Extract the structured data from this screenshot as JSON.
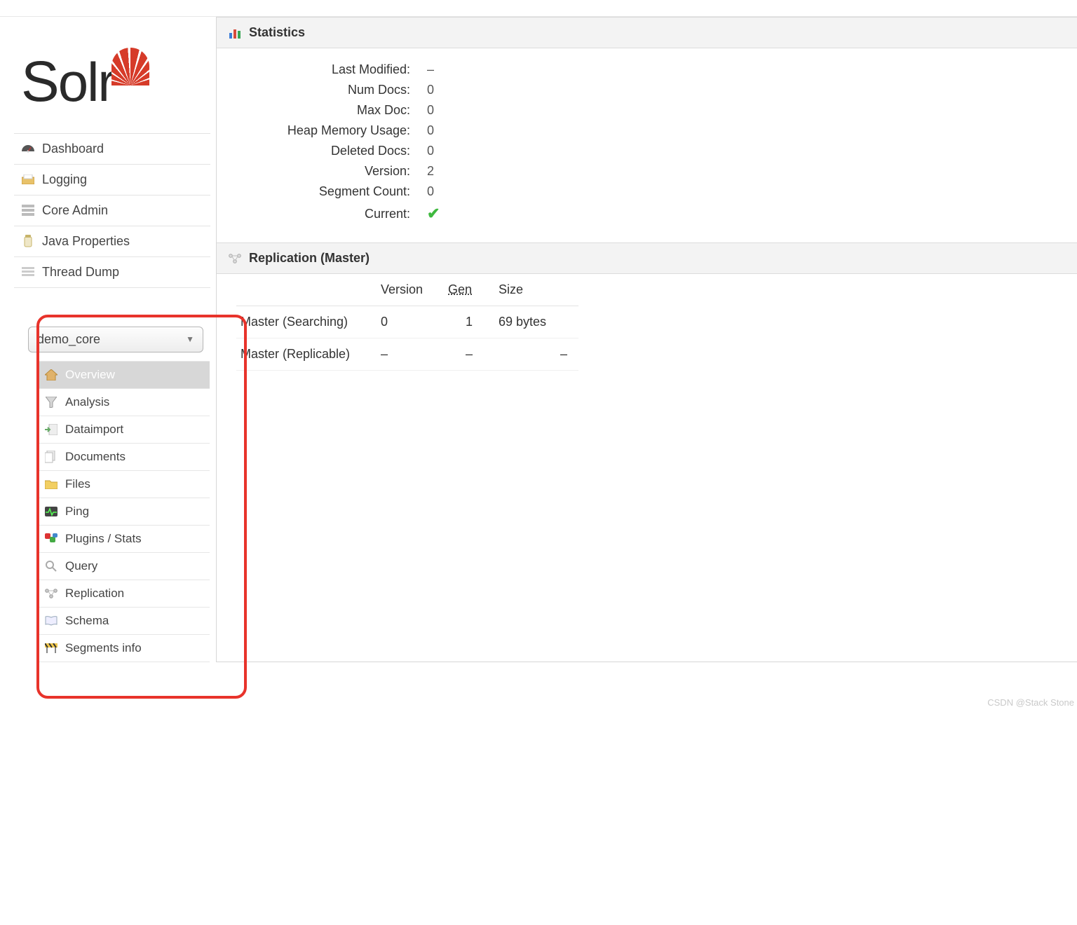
{
  "logo": {
    "name": "Solr"
  },
  "nav": {
    "items": [
      {
        "label": "Dashboard",
        "icon": "gauge-icon"
      },
      {
        "label": "Logging",
        "icon": "inbox-icon"
      },
      {
        "label": "Core Admin",
        "icon": "servers-icon"
      },
      {
        "label": "Java Properties",
        "icon": "jar-icon"
      },
      {
        "label": "Thread Dump",
        "icon": "threads-icon"
      }
    ]
  },
  "core_selector": {
    "selected": "demo_core"
  },
  "core_submenu": {
    "items": [
      {
        "label": "Overview",
        "icon": "house-icon",
        "active": true
      },
      {
        "label": "Analysis",
        "icon": "funnel-icon"
      },
      {
        "label": "Dataimport",
        "icon": "import-icon"
      },
      {
        "label": "Documents",
        "icon": "documents-icon"
      },
      {
        "label": "Files",
        "icon": "folder-icon"
      },
      {
        "label": "Ping",
        "icon": "heartbeat-icon"
      },
      {
        "label": "Plugins / Stats",
        "icon": "plugins-icon"
      },
      {
        "label": "Query",
        "icon": "magnifier-icon"
      },
      {
        "label": "Replication",
        "icon": "replication-icon"
      },
      {
        "label": "Schema",
        "icon": "book-icon"
      },
      {
        "label": "Segments info",
        "icon": "barrier-icon"
      }
    ]
  },
  "statistics": {
    "header": "Statistics",
    "rows": [
      {
        "label": "Last Modified:",
        "value": "–"
      },
      {
        "label": "Num Docs:",
        "value": "0"
      },
      {
        "label": "Max Doc:",
        "value": "0"
      },
      {
        "label": "Heap Memory Usage:",
        "value": "0"
      },
      {
        "label": "Deleted Docs:",
        "value": "0"
      },
      {
        "label": "Version:",
        "value": "2"
      },
      {
        "label": "Segment Count:",
        "value": "0"
      },
      {
        "label": "Current:",
        "value": "check"
      }
    ]
  },
  "replication": {
    "header": "Replication (Master)",
    "columns": {
      "c1": "",
      "version": "Version",
      "gen": "Gen",
      "size": "Size"
    },
    "rows": [
      {
        "name": "Master (Searching)",
        "version": "0",
        "gen": "1",
        "size": "69 bytes"
      },
      {
        "name": "Master (Replicable)",
        "version": "–",
        "gen": "–",
        "size": "–"
      }
    ]
  },
  "watermark": "CSDN @Stack Stone"
}
